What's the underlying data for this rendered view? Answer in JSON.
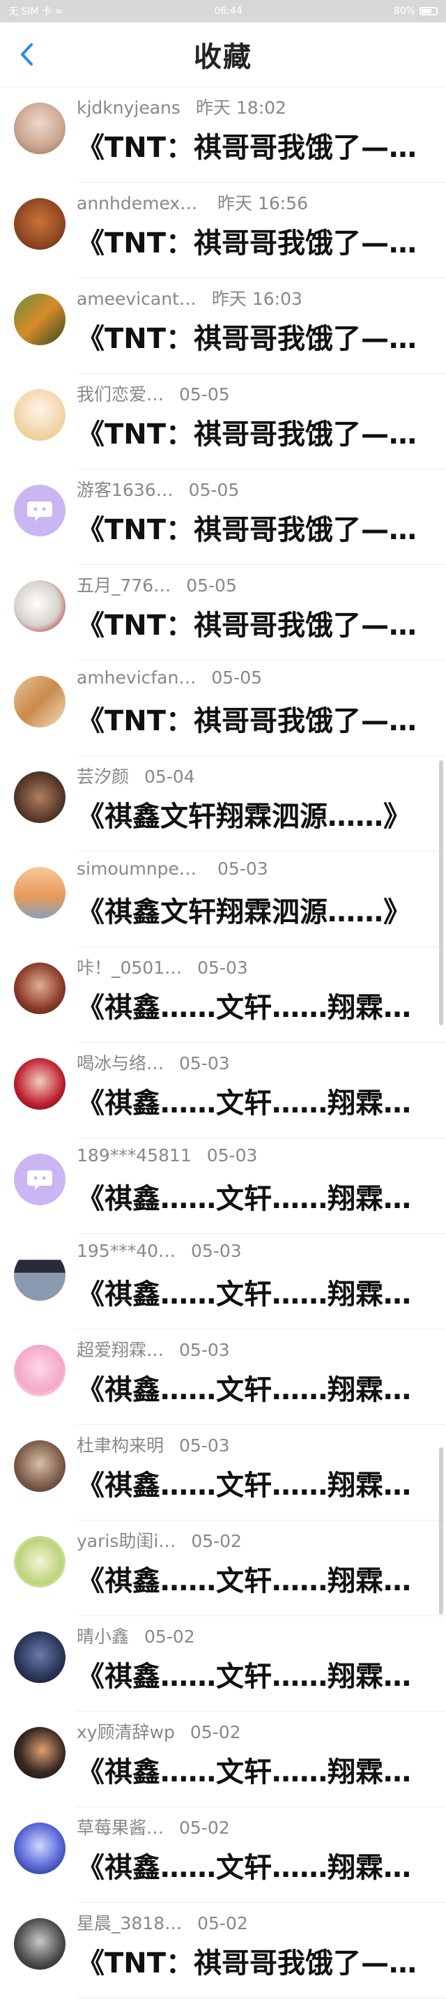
{
  "status": {
    "left": "无 SIM 卡 ≈",
    "time": "06:44",
    "battery": "80%"
  },
  "header": {
    "title": "收藏",
    "back_label": "‹"
  },
  "items": [
    {
      "name": "kjdknyjeans",
      "time": "昨天 18:02",
      "content": "《TNT：祺哥哥我饿了——d…",
      "avatar": "girl-photo"
    },
    {
      "name": "annhdemexu…",
      "time": "昨天 16:56",
      "content": "《TNT：祺哥哥我饿了——d…",
      "avatar": "bear-photo"
    },
    {
      "name": "ameevicant…",
      "time": "昨天 16:03",
      "content": "《TNT：祺哥哥我饿了——d…",
      "avatar": "tiger-photo"
    },
    {
      "name": "我们恋爱…",
      "time": "05-05",
      "content": "《TNT：祺哥哥我饿了——d…",
      "avatar": "cartoon-girl"
    },
    {
      "name": "游客1636…",
      "time": "05-05",
      "content": "《TNT：祺哥哥我饿了——d…",
      "avatar": "default-avatar"
    },
    {
      "name": "五月_776…",
      "time": "05-05",
      "content": "《TNT：祺哥哥我饿了——d…",
      "avatar": "dog-photo"
    },
    {
      "name": "amhevicfan…",
      "time": "05-05",
      "content": "《TNT：祺哥哥我饿了——d…",
      "avatar": "pencil-photo"
    },
    {
      "name": "芸汐颜",
      "time": "05-04",
      "content": "《祺鑫文轩翔霖泗源……》",
      "avatar": "teddy-photo"
    },
    {
      "name": "simoumnpee…",
      "time": "05-03",
      "content": "《祺鑫文轩翔霖泗源……》",
      "avatar": "sunset-photo"
    },
    {
      "name": "咔！_0501…",
      "time": "05-03",
      "content": "《祺鑫……文轩……翔霖……",
      "avatar": "boy-photo"
    },
    {
      "name": "喝冰与络…",
      "time": "05-03",
      "content": "《祺鑫……文轩……翔霖……",
      "avatar": "costume-photo"
    },
    {
      "name": "189***45811",
      "time": "05-03",
      "content": "《祺鑫……文轩……翔霖……",
      "avatar": "default-avatar"
    },
    {
      "name": "195***40…",
      "time": "05-03",
      "content": "《祺鑫……文轩……翔霖……",
      "avatar": "screenshot-photo"
    },
    {
      "name": "超爱翔霖…",
      "time": "05-03",
      "content": "《祺鑫……文轩……翔霖……",
      "avatar": "pink-photo"
    },
    {
      "name": "杜聿构来明",
      "time": "05-03",
      "content": "《祺鑫……文轩……翔霖……",
      "avatar": "cloak-photo"
    },
    {
      "name": "yaris助闺i…",
      "time": "05-02",
      "content": "《祺鑫……文轩……翔霖……",
      "avatar": "leaf-cartoon"
    },
    {
      "name": "晴小鑫",
      "time": "05-02",
      "content": "《祺鑫……文轩……翔霖……",
      "avatar": "stage-photo"
    },
    {
      "name": "xy顾清辞wp",
      "time": "05-02",
      "content": "《祺鑫……文轩……翔霖……",
      "avatar": "dark-photo"
    },
    {
      "name": "草莓果酱…",
      "time": "05-02",
      "content": "《祺鑫……文轩……翔霖……",
      "avatar": "blue-photo"
    },
    {
      "name": "星晨_3818…",
      "time": "05-02",
      "content": "《TNT：祺哥哥我饿了——d…",
      "avatar": "portrait-photo"
    }
  ]
}
